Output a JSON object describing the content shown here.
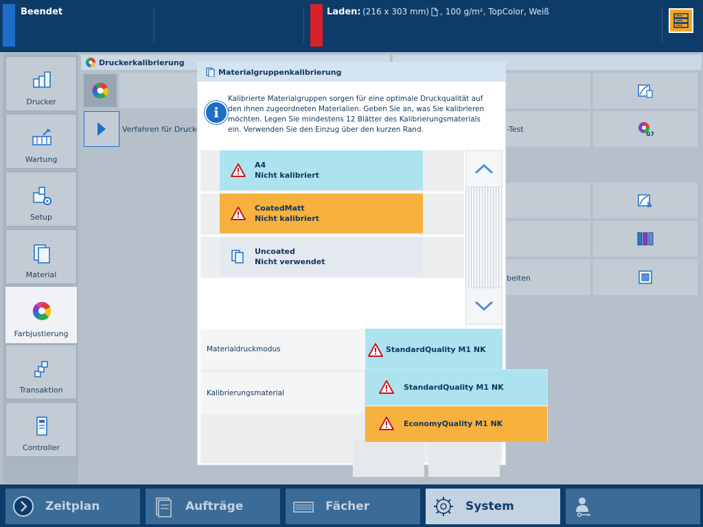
{
  "topbar": {
    "status": "Beendet",
    "load_label": "Laden:",
    "load_dims": "(216 x 303 mm)",
    "load_props": ", 100 g/m², TopColor, Weiß",
    "server_icon": "server-icon"
  },
  "leftnav": {
    "items": [
      {
        "label": "Drucker",
        "icon": "printer-icon"
      },
      {
        "label": "Wartung",
        "icon": "maintenance-icon"
      },
      {
        "label": "Setup",
        "icon": "setup-icon"
      },
      {
        "label": "Material",
        "icon": "media-icon"
      },
      {
        "label": "Farbjustierung",
        "icon": "color-wheel-icon",
        "active": true
      },
      {
        "label": "Transaktion",
        "icon": "transaction-icon"
      },
      {
        "label": "Controller",
        "icon": "controller-icon"
      }
    ]
  },
  "content": {
    "header": "Druckerkalibrierung",
    "procedure_label": "Verfahren für Druckerk",
    "right_labels": [
      "-Test",
      "beiten"
    ]
  },
  "modal": {
    "title": "Materialgruppenkalibrierung",
    "info": "Kalibrierte Materialgruppen sorgen für eine optimale Druckqualität auf den ihnen zugeordneten Materialien. Geben Sie an, was Sie kalibrieren möchten. Legen Sie mindestens 12 Blätter des Kalibrierungsmaterials ein. Verwenden Sie den Einzug über den kurzen Rand.",
    "items": [
      {
        "name": "A4",
        "status": "Nicht kalibriert",
        "icon": "warning-icon"
      },
      {
        "name": "CoatedMatt",
        "status": "Nicht kalibriert",
        "icon": "warning-icon"
      },
      {
        "name": "Uncoated",
        "status": "Nicht verwendet",
        "icon": "media-icon"
      }
    ],
    "print_mode_label": "Materialdruckmodus",
    "print_mode_value": "StandardQuality M1 NK",
    "calibration_material_label": "Kalibrierungsmaterial"
  },
  "dropdown": {
    "options": [
      "StandardQuality M1 NK",
      "EconomyQuality M1 NK"
    ]
  },
  "bottomnav": {
    "items": [
      {
        "label": "Zeitplan",
        "icon": "schedule-icon"
      },
      {
        "label": "Aufträge",
        "icon": "jobs-icon"
      },
      {
        "label": "Fächer",
        "icon": "trays-icon"
      },
      {
        "label": "System",
        "icon": "gear-icon",
        "active": true
      },
      {
        "label": "",
        "icon": "user-key-icon"
      }
    ]
  },
  "colors": {
    "navy": "#0e3c69",
    "accent_blue": "#1e6ec8",
    "alert_red": "#d8202a",
    "cyan_item": "#ace3ee",
    "orange_item": "#f7b13e",
    "warning_red": "#d0101c"
  }
}
